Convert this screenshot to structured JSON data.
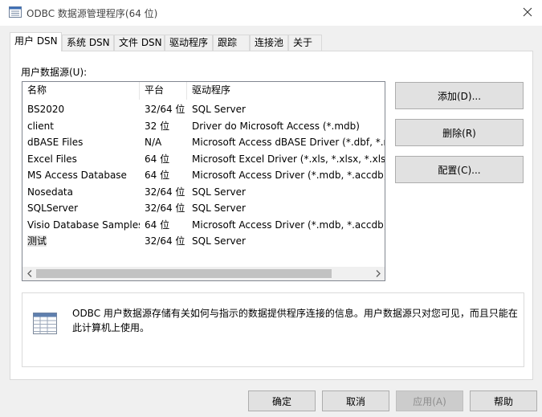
{
  "window": {
    "title": "ODBC 数据源管理程序(64 位)"
  },
  "tabs": [
    {
      "label": "用户 DSN",
      "active": true
    },
    {
      "label": "系统 DSN"
    },
    {
      "label": "文件 DSN"
    },
    {
      "label": "驱动程序"
    },
    {
      "label": "跟踪"
    },
    {
      "label": "连接池"
    },
    {
      "label": "关于"
    }
  ],
  "user_dsn": {
    "list_label": "用户数据源(U):",
    "columns": [
      "名称",
      "平台",
      "驱动程序"
    ],
    "rows": [
      {
        "name": "BS2020",
        "platform": "32/64 位",
        "driver": "SQL Server"
      },
      {
        "name": "client",
        "platform": "32 位",
        "driver": "Driver do Microsoft Access (*.mdb)"
      },
      {
        "name": "dBASE Files",
        "platform": "N/A",
        "driver": "Microsoft Access dBASE Driver (*.dbf, *.nd"
      },
      {
        "name": "Excel Files",
        "platform": "64 位",
        "driver": "Microsoft Excel Driver (*.xls, *.xlsx, *.xlsm, *"
      },
      {
        "name": "MS Access Database",
        "platform": "64 位",
        "driver": "Microsoft Access Driver (*.mdb, *.accdb)"
      },
      {
        "name": "Nosedata",
        "platform": "32/64 位",
        "driver": "SQL Server"
      },
      {
        "name": "SQLServer",
        "platform": "32/64 位",
        "driver": "SQL Server"
      },
      {
        "name": "Visio Database Samples",
        "platform": "64 位",
        "driver": "Microsoft Access Driver (*.mdb, *.accdb)"
      },
      {
        "name": "测试",
        "platform": "32/64 位",
        "driver": "SQL Server",
        "selected": true
      }
    ],
    "buttons": {
      "add": "添加(D)...",
      "remove": "删除(R)",
      "configure": "配置(C)..."
    },
    "info_text": "ODBC 用户数据源存储有关如何与指示的数据提供程序连接的信息。用户数据源只对您可见，而且只能在此计算机上使用。"
  },
  "footer": {
    "ok": "确定",
    "cancel": "取消",
    "apply": "应用(A)",
    "help": "帮助"
  },
  "icons": {
    "app": "odbc-app-icon",
    "close": "close-icon",
    "info": "database-table-icon",
    "scroll_left": "chevron-left-icon",
    "scroll_right": "chevron-right-icon"
  }
}
